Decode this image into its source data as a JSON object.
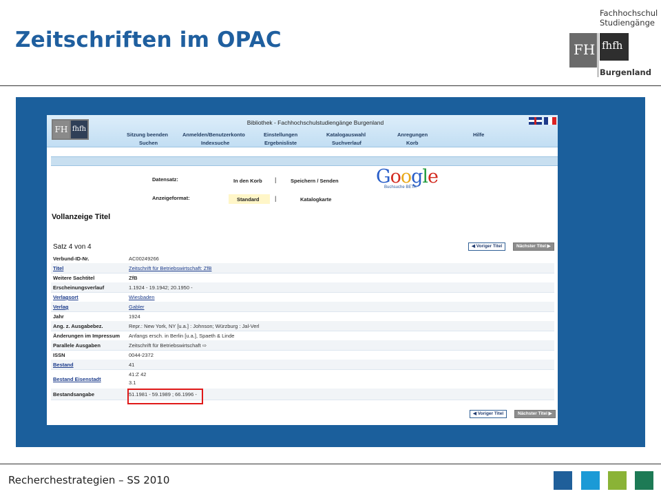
{
  "slide": {
    "title": "Zeitschriften im OPAC",
    "logo": {
      "line1": "Fachhochschul",
      "line2": "Studiengänge",
      "line3": "Burgenland",
      "mark_left": "FH",
      "mark_right": "fhfh"
    },
    "footer": "Recherchestrategien – SS 2010",
    "footer_squares": [
      "#1f5f9a",
      "#1b9ad6",
      "#8ab336",
      "#1d7a55"
    ]
  },
  "opac": {
    "library_title": "Bibliothek - Fachhochschulstudiengänge Burgenland",
    "logo_left": "FH",
    "logo_right": "fhfh",
    "nav_top": [
      "Sitzung beenden",
      "Anmelden/Benutzerkonto",
      "Einstellungen",
      "Katalogauswahl",
      "Anregungen",
      "Hilfe"
    ],
    "nav_bottom": [
      "Suchen",
      "Indexsuche",
      "Ergebnisliste",
      "Suchverlauf",
      "Korb"
    ],
    "datensatz_label": "Datensatz:",
    "datensatz_links": [
      "In den Korb",
      "Speichern / Senden"
    ],
    "anzeigeformat_label": "Anzeigeformat:",
    "anzeigeformat_links": [
      "Standard",
      "Katalogkarte"
    ],
    "separator": "|",
    "google": {
      "word": "Google",
      "sub": "Buchsuche BETA"
    },
    "heading": "Vollanzeige Titel",
    "satz": "Satz 4 von 4",
    "prev_button": "◀ Voriger Titel",
    "next_button": "Nächster Titel ▶",
    "rows": [
      {
        "label": "Verbund-ID-Nr.",
        "value": "AC00249266"
      },
      {
        "label": "Titel",
        "value": "Zeitschrift für Betriebswirtschaft: ZfB"
      },
      {
        "label": "Weitere Sachtitel",
        "value": "ZfB"
      },
      {
        "label": "Erscheinungsverlauf",
        "value": "1.1924 - 19.1942; 20.1950 -"
      },
      {
        "label": "Verlagsort",
        "value": "Wiesbaden"
      },
      {
        "label": "Verlag",
        "value": "Gabler"
      },
      {
        "label": "Jahr",
        "value": "1924"
      },
      {
        "label": "Ang. z. Ausgabebez.",
        "value": "Repr.: New York, NY [u.a.] : Johnson; Würzburg : Jal-Verl"
      },
      {
        "label": "Änderungen im Impressum",
        "value": "Anfangs ersch. in Berlin [u.a.], Spaeth & Linde"
      },
      {
        "label": "Parallele Ausgaben",
        "value": "Zeitschrift für Betriebswirtschaft ⇨"
      },
      {
        "label": "ISSN",
        "value": "0044-2372"
      },
      {
        "label": "Bestand",
        "value": "41"
      },
      {
        "label": "Bestand Eisenstadt",
        "value": "41:Z 42",
        "value2": "3.1"
      },
      {
        "label": "Bestandsangabe",
        "value": "51.1981 - 59.1989 ; 66.1996 -"
      }
    ]
  }
}
